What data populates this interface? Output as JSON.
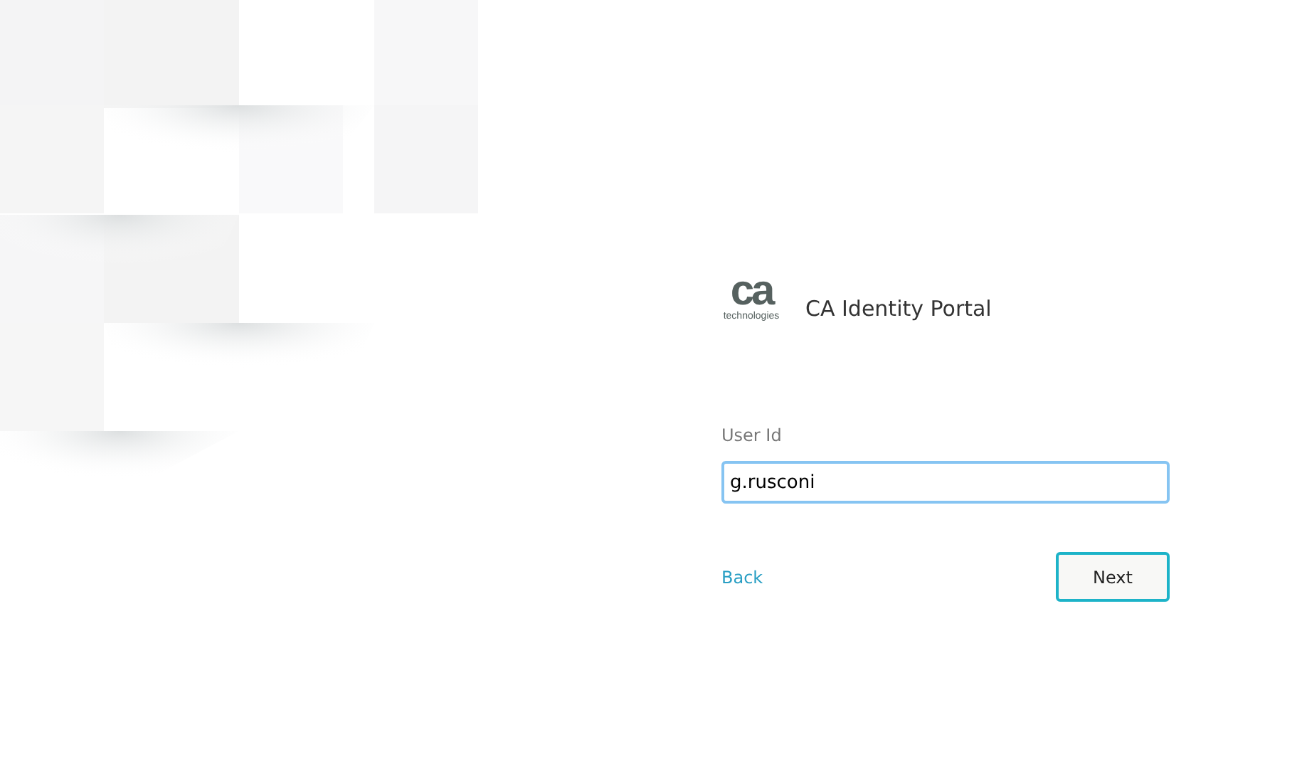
{
  "logo": {
    "mark": "ca",
    "tagline": "technologies"
  },
  "app_title": "CA Identity Portal",
  "user_id_field": {
    "label": "User Id",
    "value": "g.rusconi",
    "focused": true
  },
  "back_link": "Back",
  "next_button": "Next"
}
